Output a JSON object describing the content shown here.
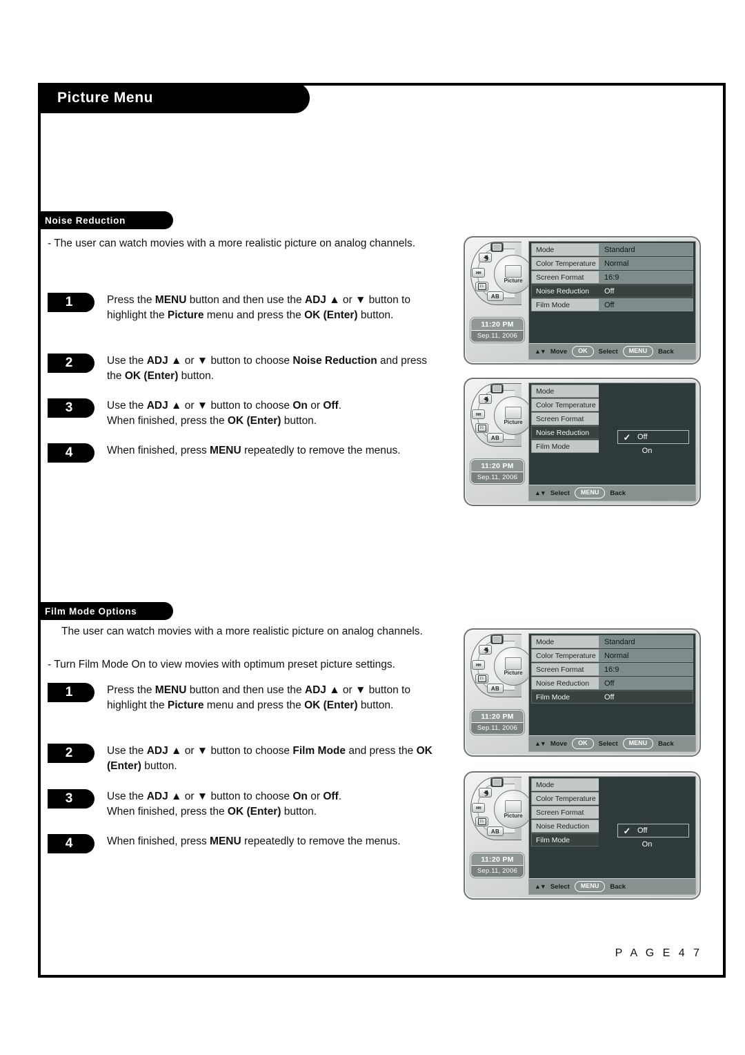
{
  "page": {
    "title": "Picture Menu",
    "page_number": "P A G E   4 7"
  },
  "sections": [
    {
      "id": "noise_reduction",
      "heading": "Noise Reduction",
      "intro": "- The user can watch movies with a more realistic picture on analog channels.",
      "steps": [
        {
          "num": "1",
          "text": "Press the MENU button and then use the ADJ ▲ or ▼ button to highlight the Picture menu and press the OK (Enter) button."
        },
        {
          "num": "2",
          "text": "Use the ADJ ▲ or ▼ button to choose Noise Reduction and press the OK (Enter) button."
        },
        {
          "num": "3",
          "text": "Use the ADJ ▲ or ▼ button to choose On or Off. When finished, press the OK (Enter) button."
        },
        {
          "num": "4",
          "text": "When finished, press MENU repeatedly to remove the menus."
        }
      ]
    },
    {
      "id": "film_mode",
      "heading": "Film Mode Options",
      "intro_a": "The user can watch movies with a more realistic picture on analog channels.",
      "intro_b": "- Turn Film Mode On to view movies with optimum preset picture settings.",
      "steps": [
        {
          "num": "1",
          "text": "Press the MENU button and then use the ADJ ▲ or ▼ button to highlight the Picture menu and press the OK (Enter) button."
        },
        {
          "num": "2",
          "text": "Use the ADJ ▲ or ▼ button to choose Film Mode and press the OK (Enter) button."
        },
        {
          "num": "3",
          "text": "Use the ADJ ▲ or ▼ button to choose On or Off. When finished, press the OK (Enter) button."
        },
        {
          "num": "4",
          "text": "When finished, press MENU repeatedly to remove the menus."
        }
      ]
    }
  ],
  "osd_common": {
    "wheel": {
      "center_label": "Picture",
      "segments": [
        {
          "name": "tv",
          "label": ""
        },
        {
          "name": "volume",
          "label": ""
        },
        {
          "name": "channel",
          "label": ""
        },
        {
          "name": "clock",
          "label": ""
        },
        {
          "name": "ab",
          "label": "AB"
        }
      ]
    },
    "clock": {
      "time": "11:20 PM",
      "date": "Sep.11, 2006"
    },
    "menu_labels": {
      "mode": "Mode",
      "color_temperature": "Color Temperature",
      "screen_format": "Screen Format",
      "noise_reduction": "Noise Reduction",
      "film_mode": "Film Mode"
    },
    "menu_values": {
      "mode": "Standard",
      "color_temperature": "Normal",
      "screen_format": "16:9",
      "noise_reduction": "Off",
      "film_mode": "Off"
    },
    "choices": {
      "off": "Off",
      "on": "On",
      "check": "✓"
    },
    "footer_move": {
      "arrows": "▲▼",
      "move": "Move",
      "ok": "OK",
      "select": "Select",
      "menu": "MENU",
      "back": "Back"
    },
    "footer_select": {
      "arrows": "▲▼",
      "select_label": "Select",
      "menu": "MENU",
      "back": "Back"
    }
  },
  "colors": {
    "panel_bg": "#2f3b3a",
    "row_label": "#c3c9c7",
    "row_value": "#7e8d8b",
    "row_selected": "#38433f",
    "footer_bar": "#87918f",
    "pill_black": "#000000"
  }
}
